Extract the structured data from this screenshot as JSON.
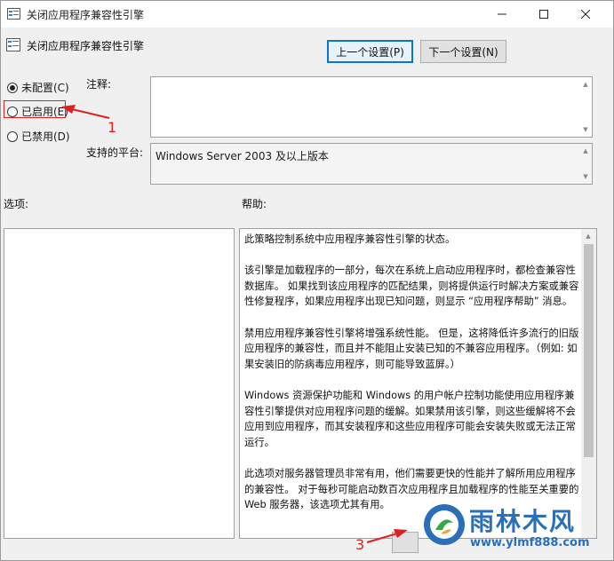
{
  "window": {
    "title": "关闭应用程序兼容性引擎",
    "controls": [
      "minimize-icon",
      "maximize-icon",
      "close-icon"
    ]
  },
  "header": {
    "title": "关闭应用程序兼容性引擎",
    "prev_button": "上一个设置(P)",
    "next_button": "下一个设置(N)"
  },
  "state_options": [
    {
      "label": "未配置(C)",
      "selected": true
    },
    {
      "label": "已启用(E)",
      "selected": false
    },
    {
      "label": "已禁用(D)",
      "selected": false
    }
  ],
  "fields": {
    "comment_label": "注释:",
    "comment_value": "",
    "platform_label": "支持的平台:",
    "platform_value": "Windows Server 2003 及以上版本",
    "options_label": "选项:",
    "help_label": "帮助:"
  },
  "help": {
    "paragraphs": [
      "  此策略控制系统中应用程序兼容性引擎的状态。",
      "该引擎是加载程序的一部分，每次在系统上启动应用程序时，都检查兼容性数据库。 如果找到该应用程序的匹配结果，则将提供运行时解决方案或兼容性修复程序，如果应用程序出现已知问题，则显示 “应用程序帮助” 消息。",
      "禁用应用程序兼容性引擎将增强系统性能。 但是，这将降低许多流行的旧版应用程序的兼容性，而且并不能阻止安装已知的不兼容应用程序。（例如: 如果安装旧的防病毒应用程序，则可能导致蓝屏。）",
      "Windows 资源保护功能和 Windows 的用户帐户控制功能使用应用程序兼容性引擎提供对应用程序问题的缓解。如果禁用该引擎，则这些缓解将不会应用到应用程序，而其安装程序和这些应用程序可能会安装失败或无法正常运行。",
      "此选项对服务器管理员非常有用，他们需要更快的性能并了解所用应用程序的兼容性。 对于每秒可能启动数百次应用程序且加载程序的性能至关重要的 Web 服务器，该选项尤其有用。"
    ]
  },
  "annotations": {
    "step1": "1",
    "step3": "3",
    "color": "#e02020"
  },
  "watermark": {
    "name": "雨林木风",
    "url": "www.ylmf888.com",
    "color": "#2a6fb8"
  }
}
